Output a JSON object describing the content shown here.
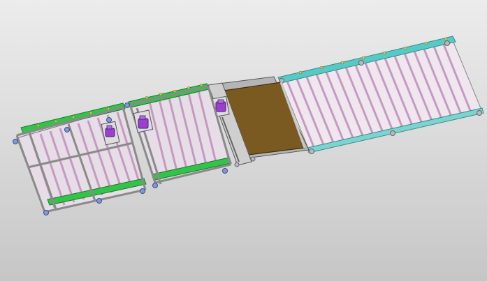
{
  "viewport": {
    "background_top": "#ececec",
    "background_bottom": "#c6c6c6"
  },
  "model": {
    "modules": [
      {
        "name": "roller-conveyor-section-1",
        "side_rail_color": "#33c24a",
        "roller_color": "#cfa6cc",
        "frame_color": "#9a9a9a"
      },
      {
        "name": "roller-conveyor-section-2",
        "side_rail_color": "#33c24a",
        "roller_color": "#cfa6cc",
        "frame_color": "#9a9a9a"
      },
      {
        "name": "transfer-plate",
        "plate_color": "#7b5a22",
        "frame_color": "#9a9a9a"
      },
      {
        "name": "long-roller-conveyor",
        "side_rail_color": "#58c9c4",
        "roller_color": "#cfa6cc",
        "frame_color": "#9a9a9a"
      }
    ],
    "drive_motor_color": "#9a3fd0",
    "foot_color": "#6f8fd0"
  }
}
